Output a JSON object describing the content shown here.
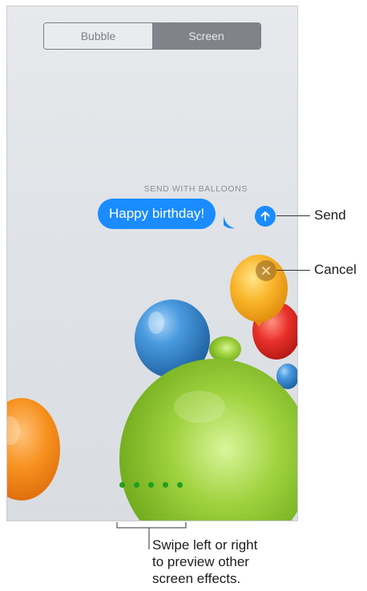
{
  "segmented_control": {
    "options": [
      "Bubble",
      "Screen"
    ],
    "selected": "Screen"
  },
  "effect": {
    "title": "SEND WITH BALLOONS"
  },
  "message": {
    "text": "Happy birthday!"
  },
  "send_button": {
    "icon": "arrow-up-icon"
  },
  "cancel_button": {
    "icon": "close-icon"
  },
  "page_dots": {
    "count": 5
  },
  "callouts": {
    "send": "Send",
    "cancel": "Cancel",
    "swipe": "Swipe left or right\nto preview other\nscreen effects."
  },
  "colors": {
    "imessage_blue": "#1a8cff",
    "balloon_green": "#8cc63f",
    "balloon_blue": "#3a8ed6",
    "balloon_orange": "#f7911e",
    "balloon_yellow": "#f9b52a",
    "balloon_red": "#e8302a",
    "dot_green": "#1ea01e"
  }
}
